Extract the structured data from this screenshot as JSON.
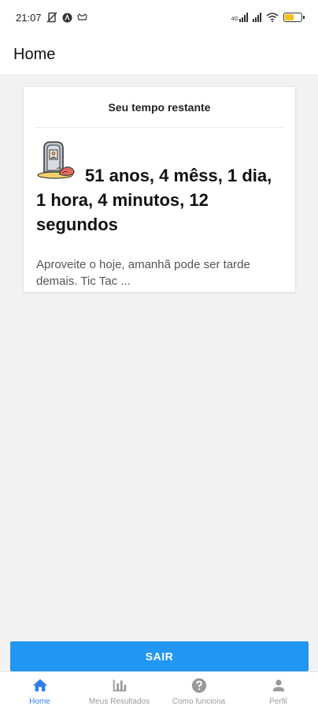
{
  "status_bar": {
    "time": "21:07",
    "network": "4G",
    "icons": [
      "no-sim-icon",
      "circle-a-icon",
      "cat-icon",
      "signal-icon",
      "wifi-icon",
      "battery-icon"
    ],
    "battery_level": 0.55,
    "battery_color": "#f2c21b"
  },
  "header": {
    "title": "Home"
  },
  "card": {
    "heading": "Seu tempo restante",
    "icon": "tombstone-icon",
    "time_remaining": "51 anos, 4 mêss, 1 dia, 1 hora, 4 minutos, 12 segundos",
    "message": "Aproveite o hoje, amanhã pode ser tarde demais. Tic Tac ..."
  },
  "exit_button": {
    "label": "SAIR",
    "color": "#2196f3"
  },
  "tabs": [
    {
      "label": "Home",
      "icon": "home-icon",
      "active": true
    },
    {
      "label": "Meus Resultados",
      "icon": "bar-chart-icon",
      "active": false
    },
    {
      "label": "Como funciona",
      "icon": "help-icon",
      "active": false
    },
    {
      "label": "Perfil",
      "icon": "person-icon",
      "active": false
    }
  ],
  "colors": {
    "accent": "#2f80ed",
    "inactive": "#9a9a9a",
    "background": "#f2f2f2"
  }
}
